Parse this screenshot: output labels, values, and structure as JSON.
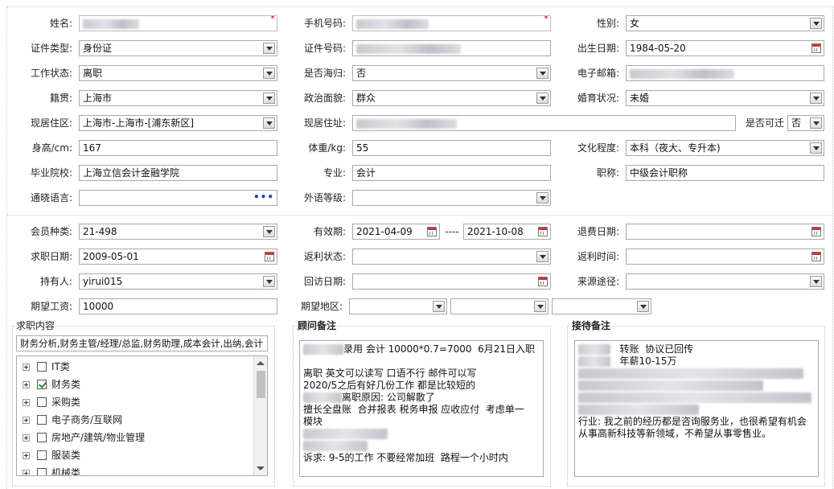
{
  "personal": {
    "name": {
      "label": "姓名:"
    },
    "phone": {
      "label": "手机号码:"
    },
    "gender": {
      "label": "性别:",
      "value": "女"
    },
    "id_type": {
      "label": "证件类型:",
      "value": "身份证"
    },
    "id_number": {
      "label": "证件号码:"
    },
    "birth_date": {
      "label": "出生日期:",
      "value": "1984-05-20"
    },
    "work_status": {
      "label": "工作状态:",
      "value": "离职"
    },
    "overseas_return": {
      "label": "是否海归:",
      "value": "否"
    },
    "email": {
      "label": "电子邮箱:"
    },
    "native_place": {
      "label": "籍贯:",
      "value": "上海市"
    },
    "political_status": {
      "label": "政治面貌:",
      "value": "群众"
    },
    "marital_status": {
      "label": "婚育状况:",
      "value": "未婚"
    },
    "residence_area": {
      "label": "现居住区:",
      "value": "上海市-上海市-[浦东新区]"
    },
    "residence_address": {
      "label": "现居住址:"
    },
    "relocatable": {
      "label": "是否可迁",
      "value": "否"
    },
    "height": {
      "label": "身高/cm:",
      "value": "167"
    },
    "weight": {
      "label": "体重/kg:",
      "value": "55"
    },
    "education": {
      "label": "文化程度:",
      "value": "本科（夜大、专升本)"
    },
    "school": {
      "label": "毕业院校:",
      "value": "上海立信会计金融学院"
    },
    "major": {
      "label": "专业:",
      "value": "会计"
    },
    "title": {
      "label": "职称:",
      "value": "中级会计职称"
    },
    "languages": {
      "label": "通晓语言:",
      "value": "",
      "more_icon": "•••"
    },
    "foreign_level": {
      "label": "外语等级:",
      "value": ""
    }
  },
  "membership": {
    "member_type": {
      "label": "会员种类:",
      "value": "21-498"
    },
    "valid_period": {
      "label": "有效期:",
      "start": "2021-04-09",
      "separator": "----",
      "end": "2021-10-08"
    },
    "refund_date": {
      "label": "退费日期:",
      "value": ""
    },
    "job_seek_date": {
      "label": "求职日期:",
      "value": "2009-05-01"
    },
    "rebate_status": {
      "label": "返利状态:",
      "value": ""
    },
    "rebate_time": {
      "label": "返利时间:",
      "value": ""
    },
    "holder": {
      "label": "持有人:",
      "value": "yirui015"
    },
    "revisit_date": {
      "label": "回访日期:",
      "value": ""
    },
    "source": {
      "label": "来源途径:",
      "value": ""
    },
    "expected_salary": {
      "label": "期望工资:",
      "value": "10000"
    },
    "expected_region": {
      "label": "期望地区:",
      "values": [
        "",
        "",
        ""
      ]
    }
  },
  "job_content": {
    "title": "求职内容",
    "summary": "财务分析,财务主管/经理/总监,财务助理,成本会计,出纳,会计",
    "categories": [
      {
        "label": "IT类",
        "checked": false
      },
      {
        "label": "财务类",
        "checked": true
      },
      {
        "label": "采购类",
        "checked": false
      },
      {
        "label": "电子商务/互联网",
        "checked": false
      },
      {
        "label": "房地产/建筑/物业管理",
        "checked": false
      },
      {
        "label": "服装类",
        "checked": false
      },
      {
        "label": "机械类",
        "checked": false
      }
    ]
  },
  "consultant_notes": {
    "title": "顾问备注",
    "line1_suffix": "录用 会计 10000*0.7=7000  6月21日入职",
    "line2": "离职 英文可以读写 口语不行 邮件可以写",
    "line3": "2020/5之后有好几份工作 都是比较短的",
    "line4_suffix": "离职原因: 公司解散了",
    "line5": "擅长全盘账  合并报表 税务申报 应收应付  考虑单一",
    "line6": "模块",
    "line8": "诉求: 9-5的工作 不要经常加班  路程一个小时内"
  },
  "reception_notes": {
    "title": "接待备注",
    "line1_suffix": "转账  协议已回传",
    "line2_suffix": "年薪10-15万",
    "line_a": "行业: 我之前的经历都是咨询服务业，也很希望有机会",
    "line_b": "从事高新科技等新领域，不希望从事零售业。"
  },
  "icons": {
    "dropdown": "chevron-down-icon",
    "calendar": "calendar-icon",
    "more": "more-dots-icon",
    "expand": "plus-box-icon",
    "checkbox": "checkbox-icon"
  },
  "colors": {
    "required_star": "#dd0000",
    "check": "#2b8a2b",
    "more_dots": "#1a4fa0"
  }
}
